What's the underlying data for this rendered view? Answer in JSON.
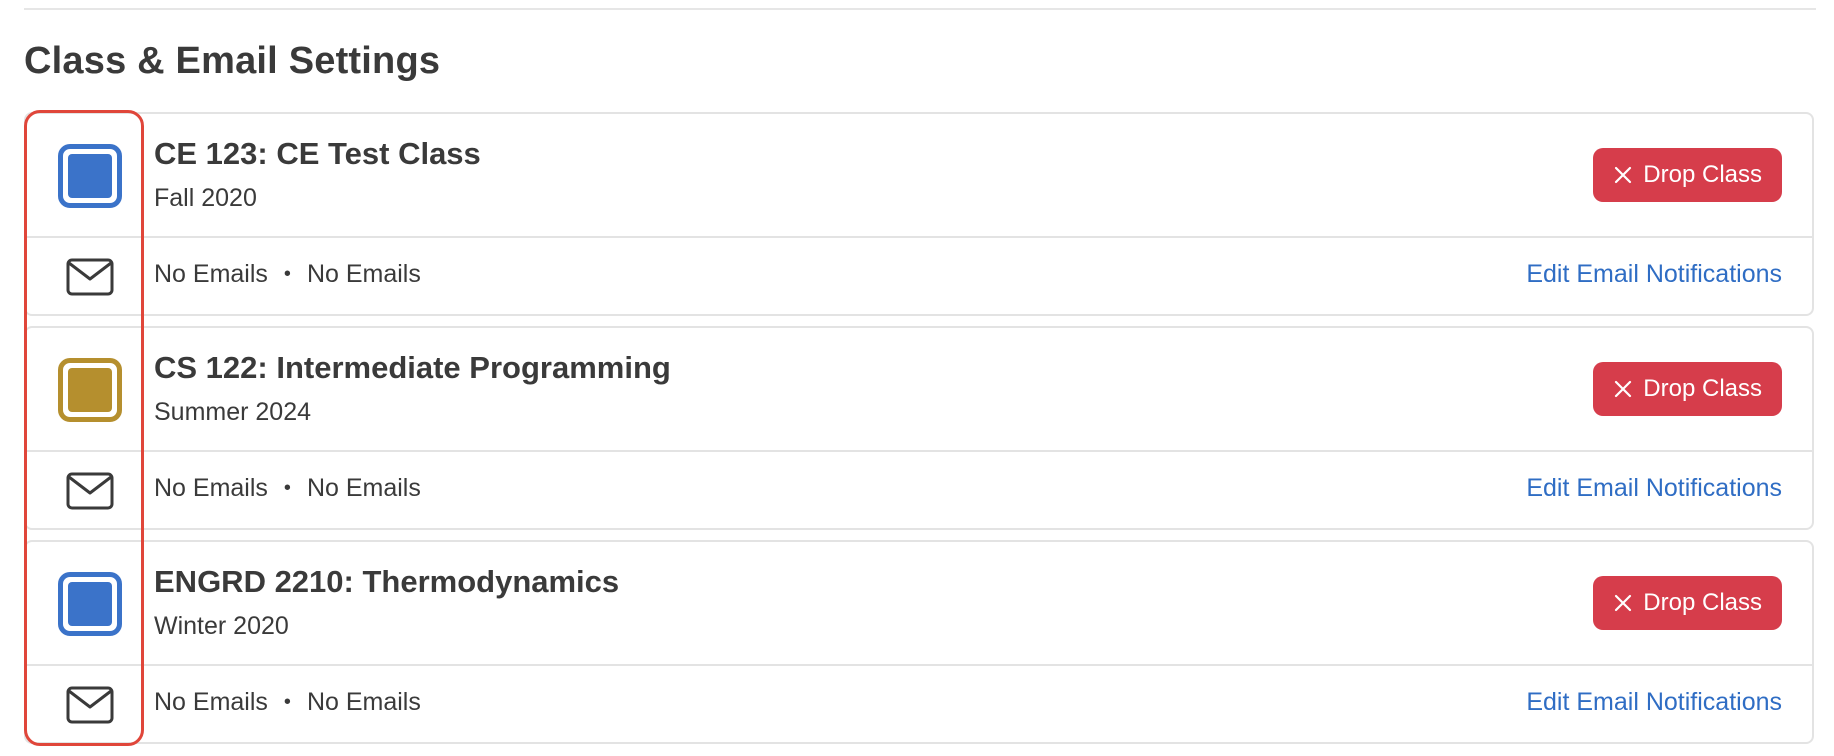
{
  "section": {
    "title": "Class & Email Settings"
  },
  "classes": [
    {
      "name": "CE 123: CE Test Class",
      "term": "Fall 2020",
      "color": "#3b73c9",
      "drop_label": "Drop Class",
      "email_status_1": "No Emails",
      "separator": "•",
      "email_status_2": "No Emails",
      "edit_label": "Edit Email Notifications"
    },
    {
      "name": "CS 122: Intermediate Programming",
      "term": "Summer 2024",
      "color": "#b58f2e",
      "drop_label": "Drop Class",
      "email_status_1": "No Emails",
      "separator": "•",
      "email_status_2": "No Emails",
      "edit_label": "Edit Email Notifications"
    },
    {
      "name": "ENGRD 2210: Thermodynamics",
      "term": "Winter 2020",
      "color": "#3b73c9",
      "drop_label": "Drop Class",
      "email_status_1": "No Emails",
      "separator": "•",
      "email_status_2": "No Emails",
      "edit_label": "Edit Email Notifications"
    }
  ],
  "icons": {
    "drop": "close-icon",
    "email": "envelope-icon"
  },
  "colors": {
    "danger": "#d63d4b",
    "link": "#2f6dc4",
    "highlight": "#e0463a"
  }
}
